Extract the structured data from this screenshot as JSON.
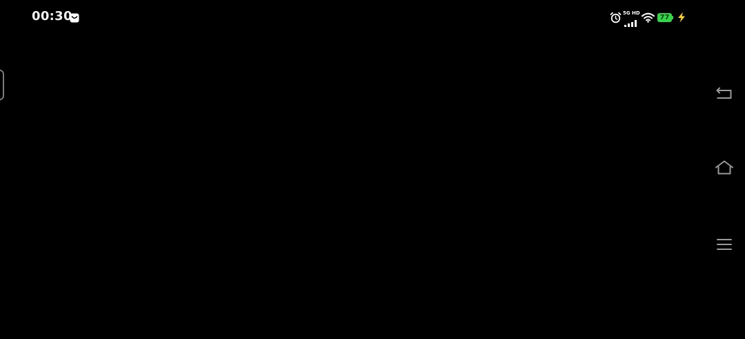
{
  "status_bar": {
    "time": "00:30",
    "notification_icon": "message-bag-icon",
    "alarm_icon": "alarm-clock-icon",
    "network_label": "5G HD",
    "signal_icon": "cell-signal-icon",
    "wifi_icon": "wifi-icon",
    "battery_level": "77",
    "battery_color": "#35d54a",
    "charging_icon": "lightning-icon",
    "charging_color": "#ffd42a"
  },
  "edge_handle": {
    "icon": "side-panel-handle-icon"
  },
  "nav_bar": {
    "back_icon": "back-arrow-icon",
    "home_icon": "home-icon",
    "menu_icon": "recents-menu-icon"
  },
  "colors": {
    "background": "#000000",
    "icon_gray": "#9a9a9a"
  }
}
